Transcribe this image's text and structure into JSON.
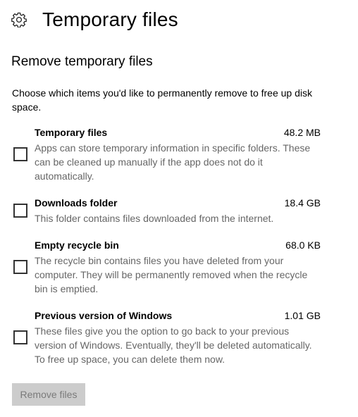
{
  "header": {
    "title": "Temporary files",
    "icon": "gear-icon"
  },
  "section": {
    "title": "Remove temporary files",
    "description": "Choose which items you'd like to permanently remove to free up disk space."
  },
  "items": [
    {
      "name": "Temporary files",
      "size": "48.2 MB",
      "description": "Apps can store temporary information in specific folders. These can be cleaned up manually if the app does not do it automatically.",
      "checked": false
    },
    {
      "name": "Downloads folder",
      "size": "18.4 GB",
      "description": "This folder contains files downloaded from the internet.",
      "checked": false
    },
    {
      "name": "Empty recycle bin",
      "size": "68.0 KB",
      "description": "The recycle bin contains files you have deleted from your computer. They will be permanently removed when the recycle bin is emptied.",
      "checked": false
    },
    {
      "name": "Previous version of Windows",
      "size": "1.01 GB",
      "description": "These files give you the option to go back to your previous version of Windows. Eventually, they'll be deleted automatically. To free up space, you can delete them now.",
      "checked": false
    }
  ],
  "actions": {
    "remove_label": "Remove files",
    "remove_disabled": true
  },
  "colors": {
    "button_disabled_bg": "#cccccc",
    "button_disabled_text": "#7a7a7a",
    "secondary_text": "#666666"
  }
}
